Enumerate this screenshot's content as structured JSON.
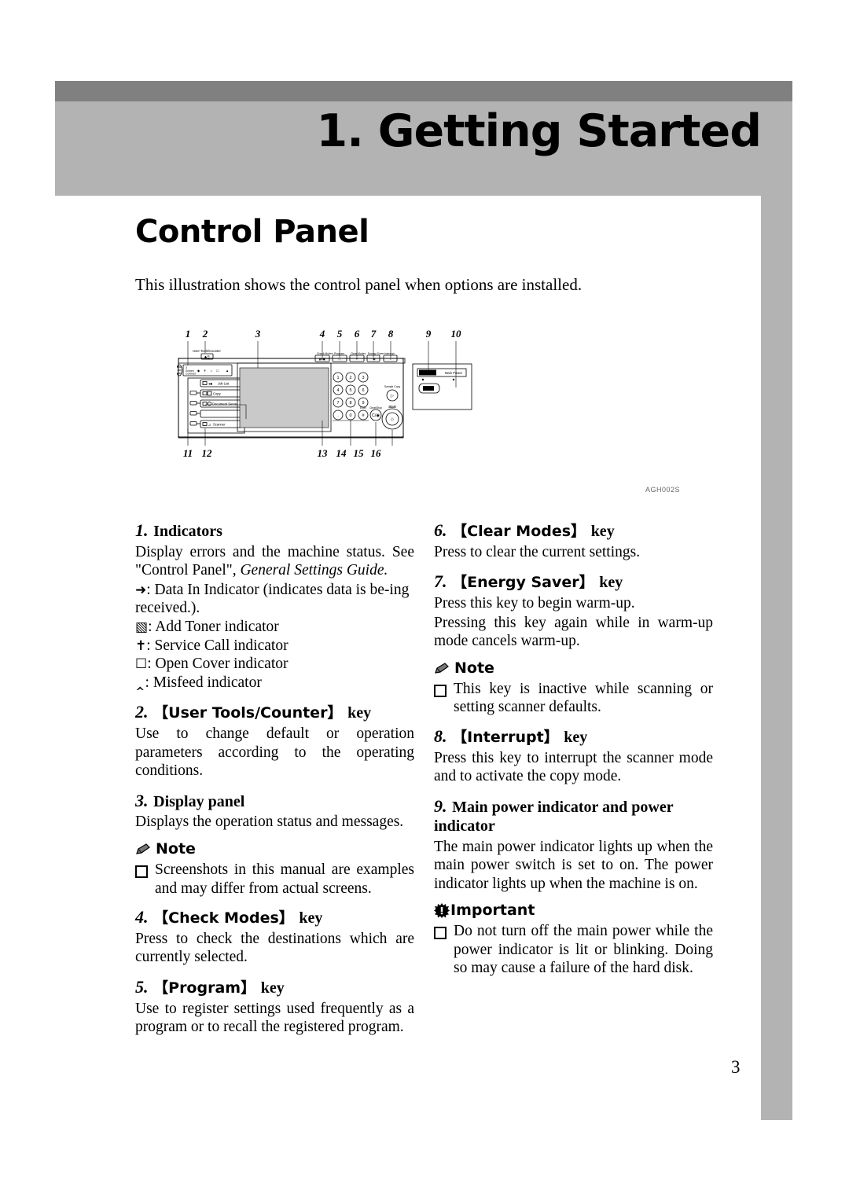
{
  "chapter": {
    "title": "1. Getting Started"
  },
  "section": {
    "title": "Control Panel",
    "intro": "This illustration shows the control panel when options are installed."
  },
  "figure": {
    "code": "AGH002S",
    "callouts_top": [
      "1",
      "2",
      "3",
      "4",
      "5",
      "6",
      "7",
      "8",
      "9",
      "10"
    ],
    "callouts_bottom": [
      "11",
      "12",
      "13",
      "14",
      "15",
      "16"
    ],
    "labels": {
      "user_tools_counter": "User Tools/Counter",
      "screen_contrast": "Screen Contrast",
      "job_list": "Job List",
      "copy": "Copy",
      "document_server": "Document Server",
      "scanner": "Scanner",
      "check_modes": "Check Modes",
      "program": "Program",
      "clear_modes": "Clear Modes",
      "energy_saver": "Energy Saver",
      "interrupt": "Interrupt",
      "main_power": "Main Power",
      "on": "On",
      "sample_copy": "Sample Copy",
      "start": "Start",
      "clear_stop": "Clear/Stop",
      "enter": "Enter",
      "keys": [
        "1",
        "2",
        "3",
        "4",
        "5",
        "6",
        "7",
        "8",
        "9",
        "0",
        ".",
        "#"
      ]
    }
  },
  "left_column": {
    "item1": {
      "num": "1.",
      "title": "Indicators",
      "p1_a": "Display errors and the machine status. See \"Control Panel\", ",
      "p1_b": "General Settings Guide.",
      "ind_data_glyph": "↪",
      "ind_data_text": ": Data In Indicator (indicates data is be-ing received.).",
      "ind_toner_text": ": Add Toner indicator",
      "ind_service_text": ": Service Call indicator",
      "ind_cover_text": ": Open Cover indicator",
      "ind_misfeed_text": ": Misfeed indicator"
    },
    "item2": {
      "num": "2.",
      "bracket_open": "【",
      "key_name": "User Tools/Counter",
      "bracket_close": "】",
      "key_word": "key",
      "body": "Use to change default or operation parameters according to the operating conditions."
    },
    "item3": {
      "num": "3.",
      "title": "Display panel",
      "body": "Displays the operation status and messages."
    },
    "note1": {
      "label": "Note",
      "bullet": "Screenshots in this manual are examples and may differ from actual screens."
    },
    "item4": {
      "num": "4.",
      "bracket_open": "【",
      "key_name": "Check Modes",
      "bracket_close": "】",
      "key_word": "key",
      "body": "Press to check the destinations which are currently selected."
    },
    "item5": {
      "num": "5.",
      "bracket_open": "【",
      "key_name": "Program",
      "bracket_close": "】",
      "key_word": "key",
      "body": "Use to register settings used frequently as a program or to recall the registered program."
    }
  },
  "right_column": {
    "item6": {
      "num": "6.",
      "bracket_open": "【",
      "key_name": "Clear Modes",
      "bracket_close": "】",
      "key_word": "key",
      "body": "Press to clear the current settings."
    },
    "item7": {
      "num": "7.",
      "bracket_open": "【",
      "key_name": "Energy Saver",
      "bracket_close": "】",
      "key_word": "key",
      "body1": "Press this key to begin warm-up.",
      "body2": "Pressing this key again while in warm-up mode cancels warm-up."
    },
    "note2": {
      "label": "Note",
      "bullet": "This key is inactive while scanning or setting scanner defaults."
    },
    "item8": {
      "num": "8.",
      "bracket_open": "【",
      "key_name": "Interrupt",
      "bracket_close": "】",
      "key_word": "key",
      "body": "Press this key to interrupt the scanner mode and to activate the copy mode."
    },
    "item9": {
      "num": "9.",
      "title": "Main power indicator and power indicator",
      "body": "The main power indicator lights up when the main power switch is set to on. The power indicator lights up when the machine is on."
    },
    "important": {
      "label": "Important",
      "bullet": "Do not turn off the main power while the power indicator is lit or blinking. Doing so may cause a failure of the hard disk."
    }
  },
  "page_number": "3",
  "colors": {
    "band_dark": "#808080",
    "band_light": "#b3b3b3",
    "text": "#000000",
    "screen_fill": "#c9c9c9"
  }
}
